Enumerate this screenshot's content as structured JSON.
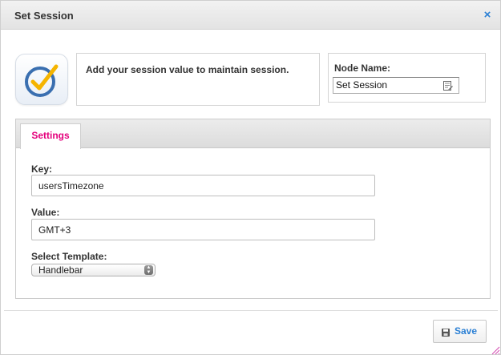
{
  "dialog": {
    "title": "Set Session",
    "close_icon": "close-icon",
    "close_symbol": "×"
  },
  "info": {
    "icon": "checkmark-clock-icon",
    "text": "Add your session value to maintain session."
  },
  "node": {
    "label": "Node Name:",
    "value": "Set Session",
    "edit_icon": "edit-icon"
  },
  "tabs": [
    {
      "label": "Settings",
      "active": true
    }
  ],
  "fields": {
    "key": {
      "label": "Key:",
      "value": "usersTimezone"
    },
    "value": {
      "label": "Value:",
      "value": "GMT+3"
    },
    "template": {
      "label": "Select Template:",
      "selected": "Handlebar"
    }
  },
  "footer": {
    "save_label": "Save",
    "save_icon": "floppy-disk-icon"
  },
  "colors": {
    "accent_blue": "#2a7fd4",
    "tab_active": "#e4007c",
    "check_yellow": "#f5b400",
    "ring_blue": "#3a6fb0"
  }
}
